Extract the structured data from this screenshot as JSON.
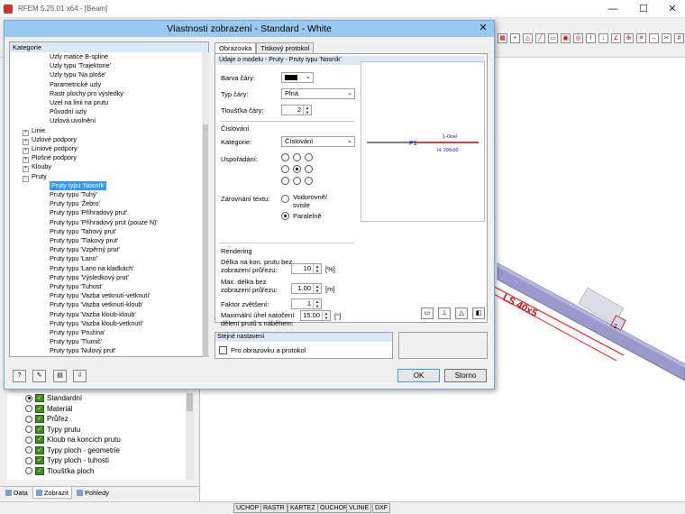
{
  "app": {
    "title": "RFEM 5.25.01 x64 - [Beam]",
    "min": "—",
    "max": "☐",
    "close": "✕"
  },
  "navigator": {
    "items": [
      {
        "label": "Standardní",
        "checked": true
      },
      {
        "label": "Materiál",
        "checked": false
      },
      {
        "label": "Průřez",
        "checked": false
      },
      {
        "label": "Typy prutu",
        "checked": false
      },
      {
        "label": "Kloub na koncích prutu",
        "checked": false
      },
      {
        "label": "Typy ploch - geometrie",
        "checked": false
      },
      {
        "label": "Typy ploch - tuhosti",
        "checked": false
      },
      {
        "label": "Tloušťka ploch",
        "checked": false
      }
    ],
    "tabs": [
      "Data",
      "Zobrazit",
      "Pohledy"
    ]
  },
  "statusbar": {
    "buttons": [
      "UCHOP",
      "RASTR",
      "KARTEZ",
      "OUCHOP",
      "VLINIE",
      "DXF"
    ]
  },
  "canvas": {
    "beam_label": "LS 40x5",
    "end_label": "2"
  },
  "dialog": {
    "title": "Vlastnosti zobrazení - Standard - White",
    "close": "✕",
    "category_header": "Kategorie",
    "tree": [
      {
        "label": "Uzly matice B-spline",
        "level": 3
      },
      {
        "label": "Uzly typu 'Trajektorie'",
        "level": 3
      },
      {
        "label": "Uzly typu 'Na ploše'",
        "level": 3
      },
      {
        "label": "Parametrické uzly",
        "level": 3
      },
      {
        "label": "Rastr plochy pro výsledky",
        "level": 3
      },
      {
        "label": "Uzel na linii na prutu",
        "level": 3
      },
      {
        "label": "Původní uzly",
        "level": 3
      },
      {
        "label": "Uzlová uvolnění",
        "level": 3
      },
      {
        "label": "Linie",
        "level": 2,
        "exp": "+"
      },
      {
        "label": "Uzlové podpory",
        "level": 2,
        "exp": "+"
      },
      {
        "label": "Liniové podpory",
        "level": 2,
        "exp": "+"
      },
      {
        "label": "Plošné podpory",
        "level": 2,
        "exp": "+"
      },
      {
        "label": "Klouby",
        "level": 2,
        "exp": "+"
      },
      {
        "label": "Pruty",
        "level": 2,
        "exp": "−"
      },
      {
        "label": "Pruty typu 'Nosník'",
        "level": 3,
        "selected": true
      },
      {
        "label": "Pruty typu 'Tuhý'",
        "level": 3
      },
      {
        "label": "Pruty typu 'Žebro'",
        "level": 3
      },
      {
        "label": "Pruty typu 'Příhradový prut'",
        "level": 3
      },
      {
        "label": "Pruty typu 'Příhradový prut (pouze N)'",
        "level": 3
      },
      {
        "label": "Pruty typu 'Tahový prut'",
        "level": 3
      },
      {
        "label": "Pruty typu 'Tlakový prut'",
        "level": 3
      },
      {
        "label": "Pruty typu 'Vzpěrný prut'",
        "level": 3
      },
      {
        "label": "Pruty typu 'Lano'",
        "level": 3
      },
      {
        "label": "Pruty typu 'Lano na kladkách'",
        "level": 3
      },
      {
        "label": "Pruty typu 'Výsledkový prut'",
        "level": 3
      },
      {
        "label": "Pruty typu 'Tuhost'",
        "level": 3
      },
      {
        "label": "Pruty typu 'Vazba vetknutí-vetknutí'",
        "level": 3
      },
      {
        "label": "Pruty typu 'Vazba vetknutí-kloub'",
        "level": 3
      },
      {
        "label": "Pruty typu 'Vazba kloub-kloub'",
        "level": 3
      },
      {
        "label": "Pruty typu 'Vazba kloub-vetknutí'",
        "level": 3
      },
      {
        "label": "Pruty typu 'Pružina'",
        "level": 3
      },
      {
        "label": "Pruty typu 'Tlumič'",
        "level": 3
      },
      {
        "label": "Pruty typu 'Nulový prut'",
        "level": 3
      },
      {
        "label": "Plochy",
        "level": 2,
        "exp": "+"
      }
    ],
    "tabs": [
      "Obrazovka",
      "Tiskový protokol"
    ],
    "section_title": "Údaje o modelu - Pruty - Pruty typu 'Nosník'",
    "line_color_label": "Barva čáry:",
    "line_color": "#000000",
    "line_type_label": "Typ čáry:",
    "line_type_value": "Plná",
    "line_width_label": "Tloušťka čáry:",
    "line_width_value": "2",
    "numbering_title": "Číslování",
    "category_label": "Kategorie:",
    "category_value": "Číslování",
    "arrangement_label": "Uspořádání:",
    "text_align_label": "Zarovnání textu:",
    "align_opt1": "Vodorovně/",
    "align_opt1b": "svisle",
    "align_opt2": "Paralelně",
    "preview": {
      "member_label": "P1",
      "material_label": "1-Ocel",
      "section_label": "I4, 200x30"
    },
    "rendering_title": "Rendering",
    "len_label_1": "Délka na kon. prutu bez",
    "len_label_2": "zobrazení průřezu:",
    "len_value": "10",
    "len_unit": "[%]",
    "max_len_label_1": "Max. délka bez",
    "max_len_label_2": "zobrazení průřezu:",
    "max_len_value": "1.00",
    "max_len_unit": "[m]",
    "zoom_label": "Faktor zvětšení:",
    "zoom_value": "1",
    "angle_label_1": "Maximální úhel natočení",
    "angle_label_2": "dělení prutů s náběhem:",
    "angle_value": "15.00",
    "angle_unit": "[°]",
    "same_settings_title": "Stejné nastavení",
    "same_settings_check": "Pro obrazovku a protokol",
    "ok_label": "OK",
    "cancel_label": "Storno"
  }
}
